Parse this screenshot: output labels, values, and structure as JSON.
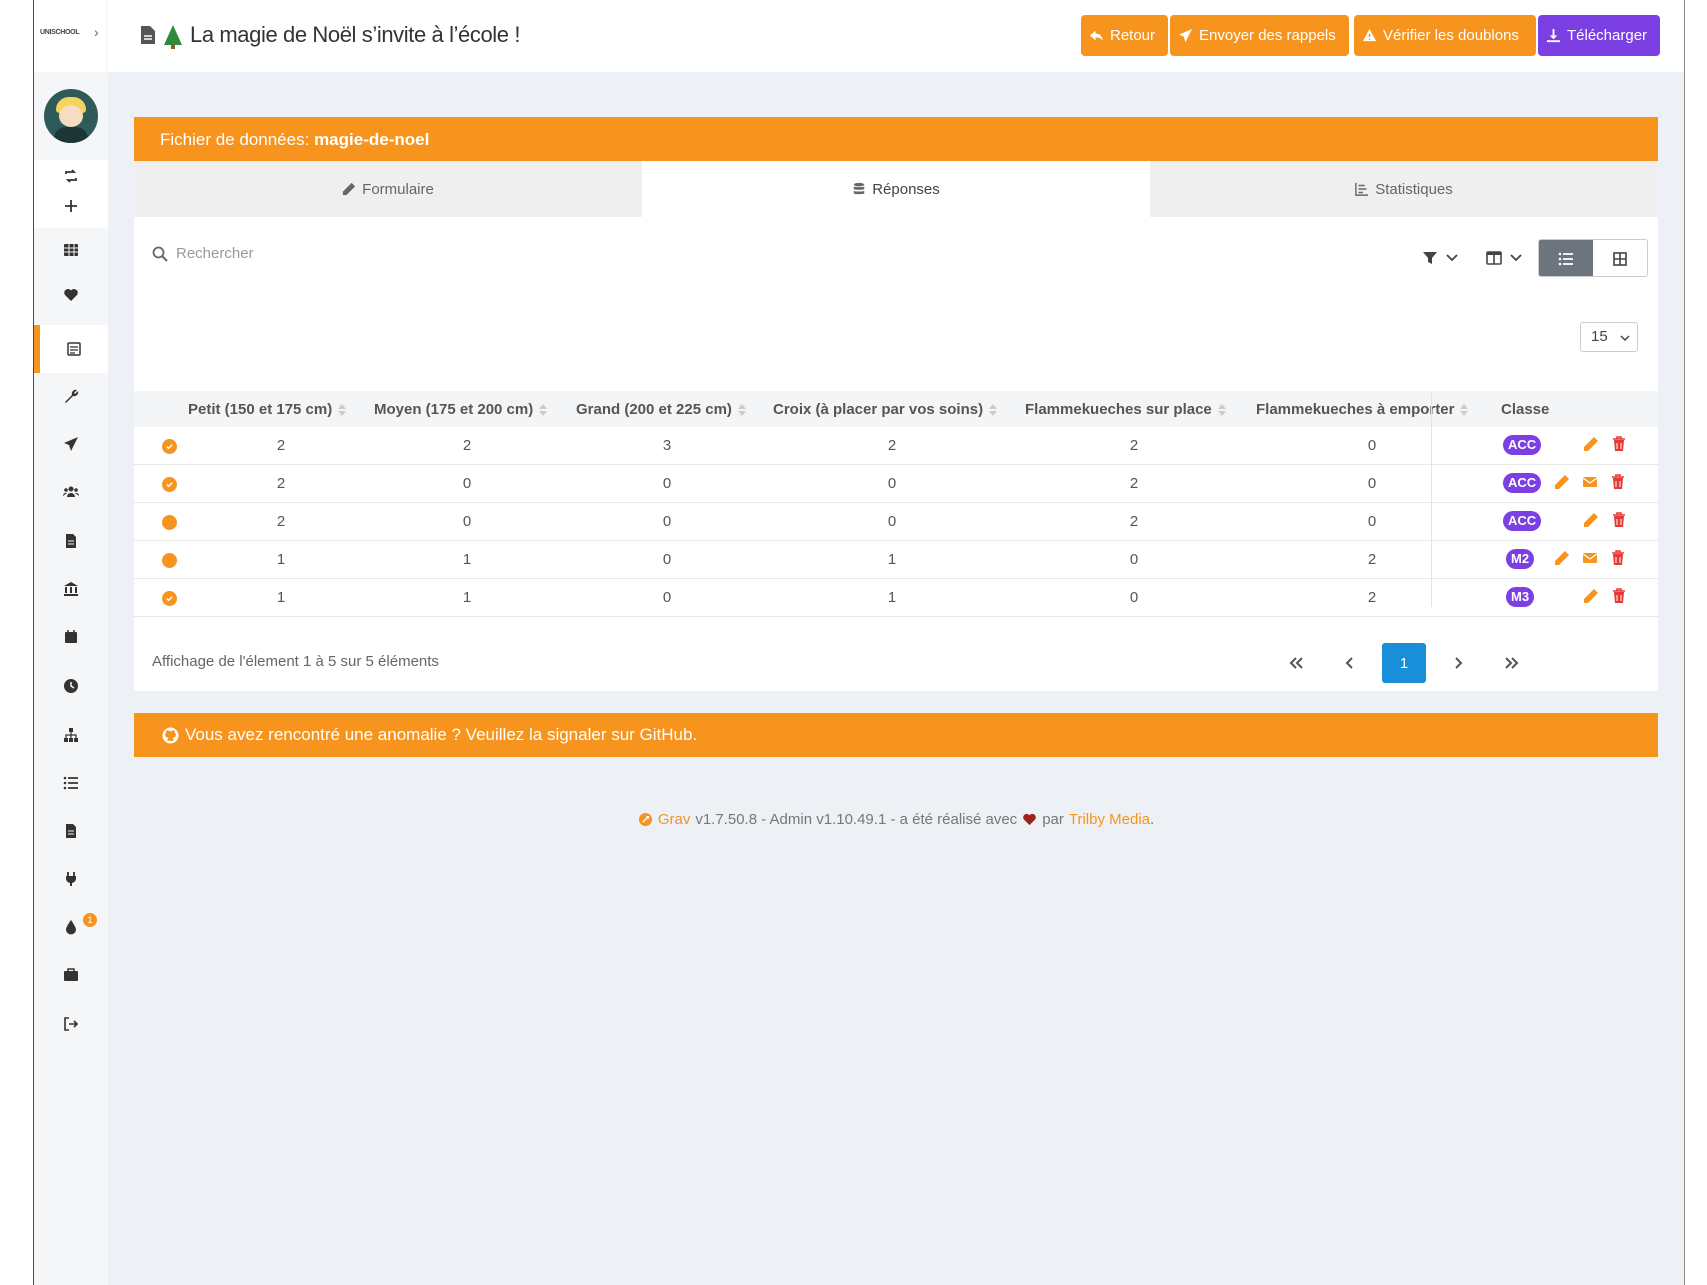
{
  "sidebar": {
    "logo": "UNISCHOOL",
    "toggle": "›",
    "badge_count": "1"
  },
  "header": {
    "title": "La magie de Noël s’invite à l’école !",
    "buttons": {
      "back": "Retour",
      "reminders": "Envoyer des rappels",
      "duplicates": "Vérifier les doublons",
      "download": "Télécharger"
    }
  },
  "card": {
    "header_label": "Fichier de données:",
    "header_file": "magie-de-noel",
    "tabs": [
      "Formulaire",
      "Réponses",
      "Statistiques"
    ],
    "active_tab": "Réponses",
    "search_placeholder": "Rechercher",
    "page_size": "15"
  },
  "table": {
    "columns": [
      "Petit (150 et 175 cm)",
      "Moyen (175 et 200 cm)",
      "Grand (200 et 225 cm)",
      "Croix (à placer par vos soins)",
      "Flammekueches sur place",
      "Flammekueches à emporter",
      "Classe"
    ],
    "rows": [
      {
        "status": "checked",
        "cells": [
          "2",
          "2",
          "3",
          "2",
          "2",
          "0"
        ],
        "classe": "ACC",
        "email": false
      },
      {
        "status": "checked",
        "cells": [
          "2",
          "0",
          "0",
          "0",
          "2",
          "0"
        ],
        "classe": "ACC",
        "email": true
      },
      {
        "status": "pending",
        "cells": [
          "2",
          "0",
          "0",
          "0",
          "2",
          "0"
        ],
        "classe": "ACC",
        "email": false
      },
      {
        "status": "pending",
        "cells": [
          "1",
          "1",
          "0",
          "1",
          "0",
          "2"
        ],
        "classe": "M2",
        "email": true
      },
      {
        "status": "checked",
        "cells": [
          "1",
          "1",
          "0",
          "1",
          "0",
          "2"
        ],
        "classe": "M3",
        "email": false
      }
    ],
    "info": "Affichage de l'élement 1 à 5 sur 5 éléments",
    "current_page": "1"
  },
  "bug_bar": "Vous avez rencontré une anomalie ? Veuillez la signaler sur GitHub.",
  "footer": {
    "grav": "Grav",
    "version_text": "v1.7.50.8 - Admin v1.10.49.1 - a été réalisé avec",
    "par": "par",
    "trilby": "Trilby Media",
    "period": "."
  },
  "colors": {
    "accent": "#f7941d",
    "purple": "#7b3fe4",
    "pager_blue": "#1a8fd9",
    "danger": "#e53935"
  }
}
